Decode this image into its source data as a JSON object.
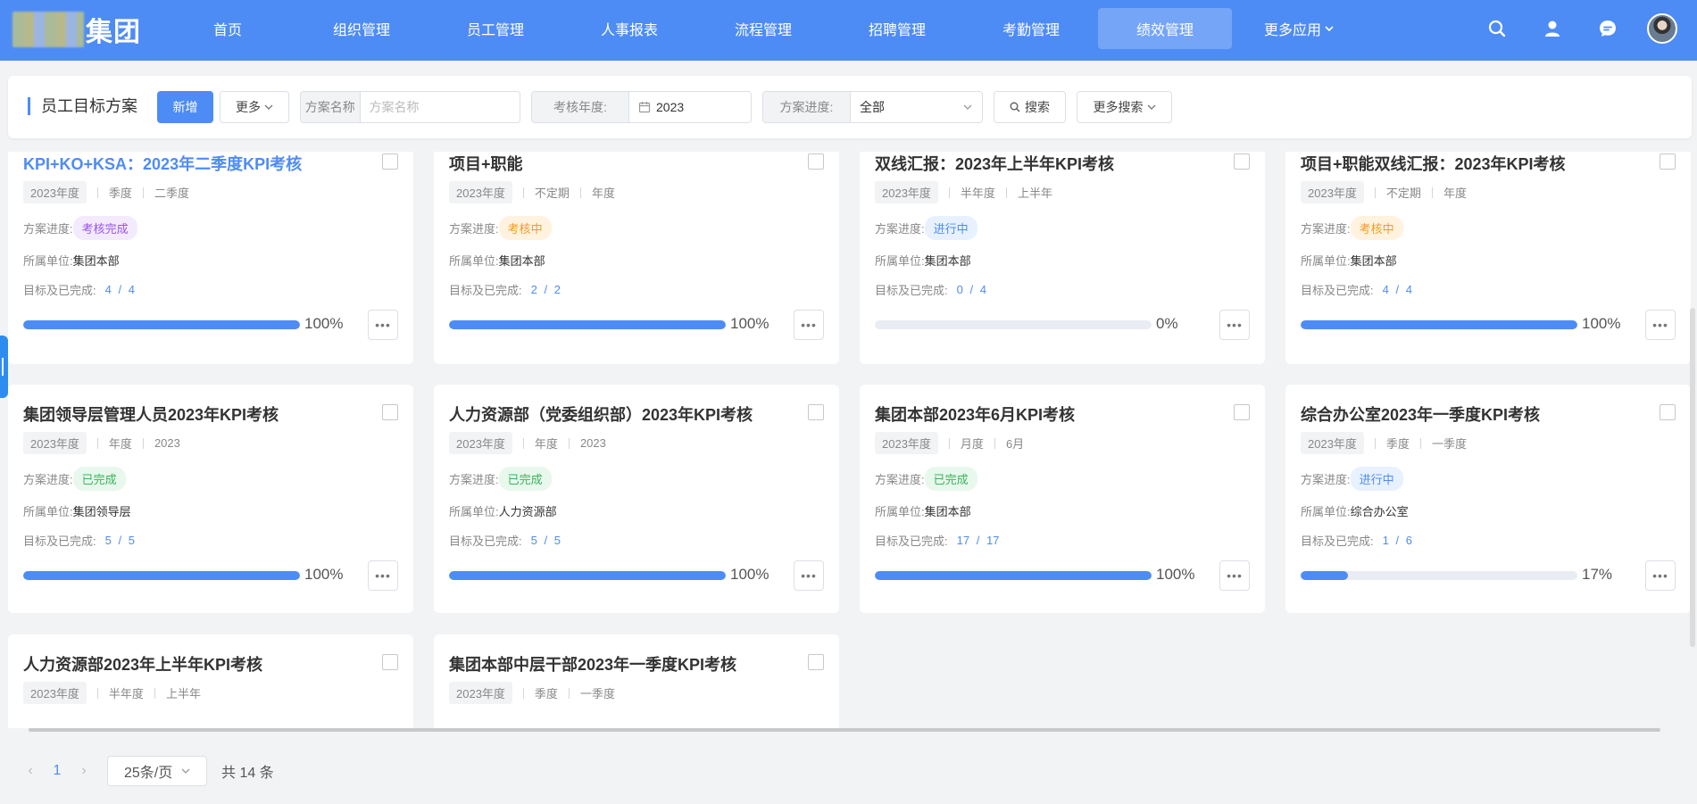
{
  "header": {
    "logo_text": "集团",
    "nav": [
      {
        "label": "首页"
      },
      {
        "label": "组织管理"
      },
      {
        "label": "员工管理"
      },
      {
        "label": "人事报表"
      },
      {
        "label": "流程管理"
      },
      {
        "label": "招聘管理"
      },
      {
        "label": "考勤管理"
      },
      {
        "label": "绩效管理",
        "active": true
      },
      {
        "label": "更多应用"
      }
    ],
    "icons": [
      "search-icon",
      "user-icon",
      "message-icon",
      "avatar"
    ]
  },
  "filters": {
    "page_title": "员工目标方案",
    "add_label": "新增",
    "more_label": "更多",
    "plan_name_label": "方案名称",
    "plan_name_placeholder": "方案名称",
    "year_label": "考核年度:",
    "year_value": "2023",
    "progress_label": "方案进度:",
    "progress_value": "全部",
    "search_label": "搜索",
    "more_search_label": "更多搜索"
  },
  "cards": [
    {
      "title": "KPI+KO+KSA：2023年二季度KPI考核",
      "year": "2023年度",
      "period_type": "季度",
      "period": "二季度",
      "status_label": "方案进度:",
      "status": "考核完成",
      "status_color": "purple",
      "unit_label": "所属单位:",
      "unit": "集团本部",
      "goal_label": "目标及已完成:",
      "done": "4",
      "total": "4",
      "progress": 100,
      "progress_text": "100%"
    },
    {
      "title": "项目+职能",
      "year": "2023年度",
      "period_type": "不定期",
      "period": "年度",
      "status_label": "方案进度:",
      "status": "考核中",
      "status_color": "orange",
      "unit_label": "所属单位:",
      "unit": "集团本部",
      "goal_label": "目标及已完成:",
      "done": "2",
      "total": "2",
      "progress": 100,
      "progress_text": "100%"
    },
    {
      "title": "双线汇报：2023年上半年KPI考核",
      "year": "2023年度",
      "period_type": "半年度",
      "period": "上半年",
      "status_label": "方案进度:",
      "status": "进行中",
      "status_color": "blue",
      "unit_label": "所属单位:",
      "unit": "集团本部",
      "goal_label": "目标及已完成:",
      "done": "0",
      "total": "4",
      "progress": 0,
      "progress_text": "0%"
    },
    {
      "title": "项目+职能双线汇报：2023年KPI考核",
      "year": "2023年度",
      "period_type": "不定期",
      "period": "年度",
      "status_label": "方案进度:",
      "status": "考核中",
      "status_color": "orange",
      "unit_label": "所属单位:",
      "unit": "集团本部",
      "goal_label": "目标及已完成:",
      "done": "4",
      "total": "4",
      "progress": 100,
      "progress_text": "100%"
    },
    {
      "title": "集团领导层管理人员2023年KPI考核",
      "year": "2023年度",
      "period_type": "年度",
      "period": "2023",
      "status_label": "方案进度:",
      "status": "已完成",
      "status_color": "green",
      "unit_label": "所属单位:",
      "unit": "集团领导层",
      "goal_label": "目标及已完成:",
      "done": "5",
      "total": "5",
      "progress": 100,
      "progress_text": "100%"
    },
    {
      "title": "人力资源部（党委组织部）2023年KPI考核",
      "year": "2023年度",
      "period_type": "年度",
      "period": "2023",
      "status_label": "方案进度:",
      "status": "已完成",
      "status_color": "green",
      "unit_label": "所属单位:",
      "unit": "人力资源部",
      "goal_label": "目标及已完成:",
      "done": "5",
      "total": "5",
      "progress": 100,
      "progress_text": "100%"
    },
    {
      "title": "集团本部2023年6月KPI考核",
      "year": "2023年度",
      "period_type": "月度",
      "period": "6月",
      "status_label": "方案进度:",
      "status": "已完成",
      "status_color": "green",
      "unit_label": "所属单位:",
      "unit": "集团本部",
      "goal_label": "目标及已完成:",
      "done": "17",
      "total": "17",
      "progress": 100,
      "progress_text": "100%"
    },
    {
      "title": "综合办公室2023年一季度KPI考核",
      "year": "2023年度",
      "period_type": "季度",
      "period": "一季度",
      "status_label": "方案进度:",
      "status": "进行中",
      "status_color": "blue",
      "unit_label": "所属单位:",
      "unit": "综合办公室",
      "goal_label": "目标及已完成:",
      "done": "1",
      "total": "6",
      "progress": 17,
      "progress_text": "17%"
    },
    {
      "title": "人力资源部2023年上半年KPI考核",
      "year": "2023年度",
      "period_type": "半年度",
      "period": "上半年"
    },
    {
      "title": "集团本部中层干部2023年一季度KPI考核",
      "year": "2023年度",
      "period_type": "季度",
      "period": "一季度"
    }
  ],
  "pagination": {
    "prev": "‹",
    "current": "1",
    "next": "›",
    "page_size": "25条/页",
    "total_text": "共 14 条"
  }
}
